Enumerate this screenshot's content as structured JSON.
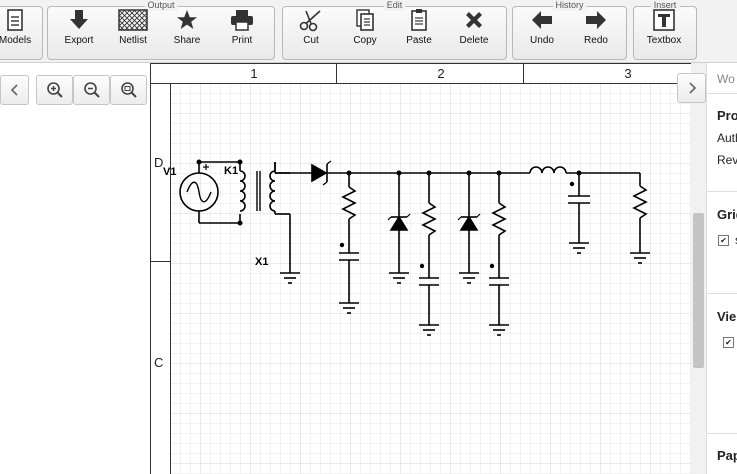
{
  "toolbar": {
    "groups": {
      "output": "Output",
      "edit": "Edit",
      "history": "History",
      "insert": "Insert"
    },
    "buttons": {
      "models": "Models",
      "export": "Export",
      "netlist": "Netlist",
      "share": "Share",
      "print": "Print",
      "cut": "Cut",
      "copy": "Copy",
      "paste": "Paste",
      "delete": "Delete",
      "undo": "Undo",
      "redo": "Redo",
      "textbox": "Textbox"
    }
  },
  "sheet": {
    "columns": [
      "1",
      "2",
      "3"
    ],
    "rows": [
      "D",
      "C"
    ]
  },
  "schematic": {
    "labels": {
      "v1": "V1",
      "k1": "K1",
      "x1": "X1"
    }
  },
  "right_panel": {
    "title": "Wo",
    "properties_heading": "Pro",
    "author_label": "Auth",
    "revision_label": "Rev",
    "grid_heading": "Grid",
    "grid_option": "s",
    "view_heading": "Vie",
    "page_heading": "Pap"
  },
  "colors": {
    "toolbar_bg": "#f2f2f2",
    "grid_minor": "#e4e4e4",
    "grid_major": "#cfcfcf",
    "wire": "#000000"
  }
}
